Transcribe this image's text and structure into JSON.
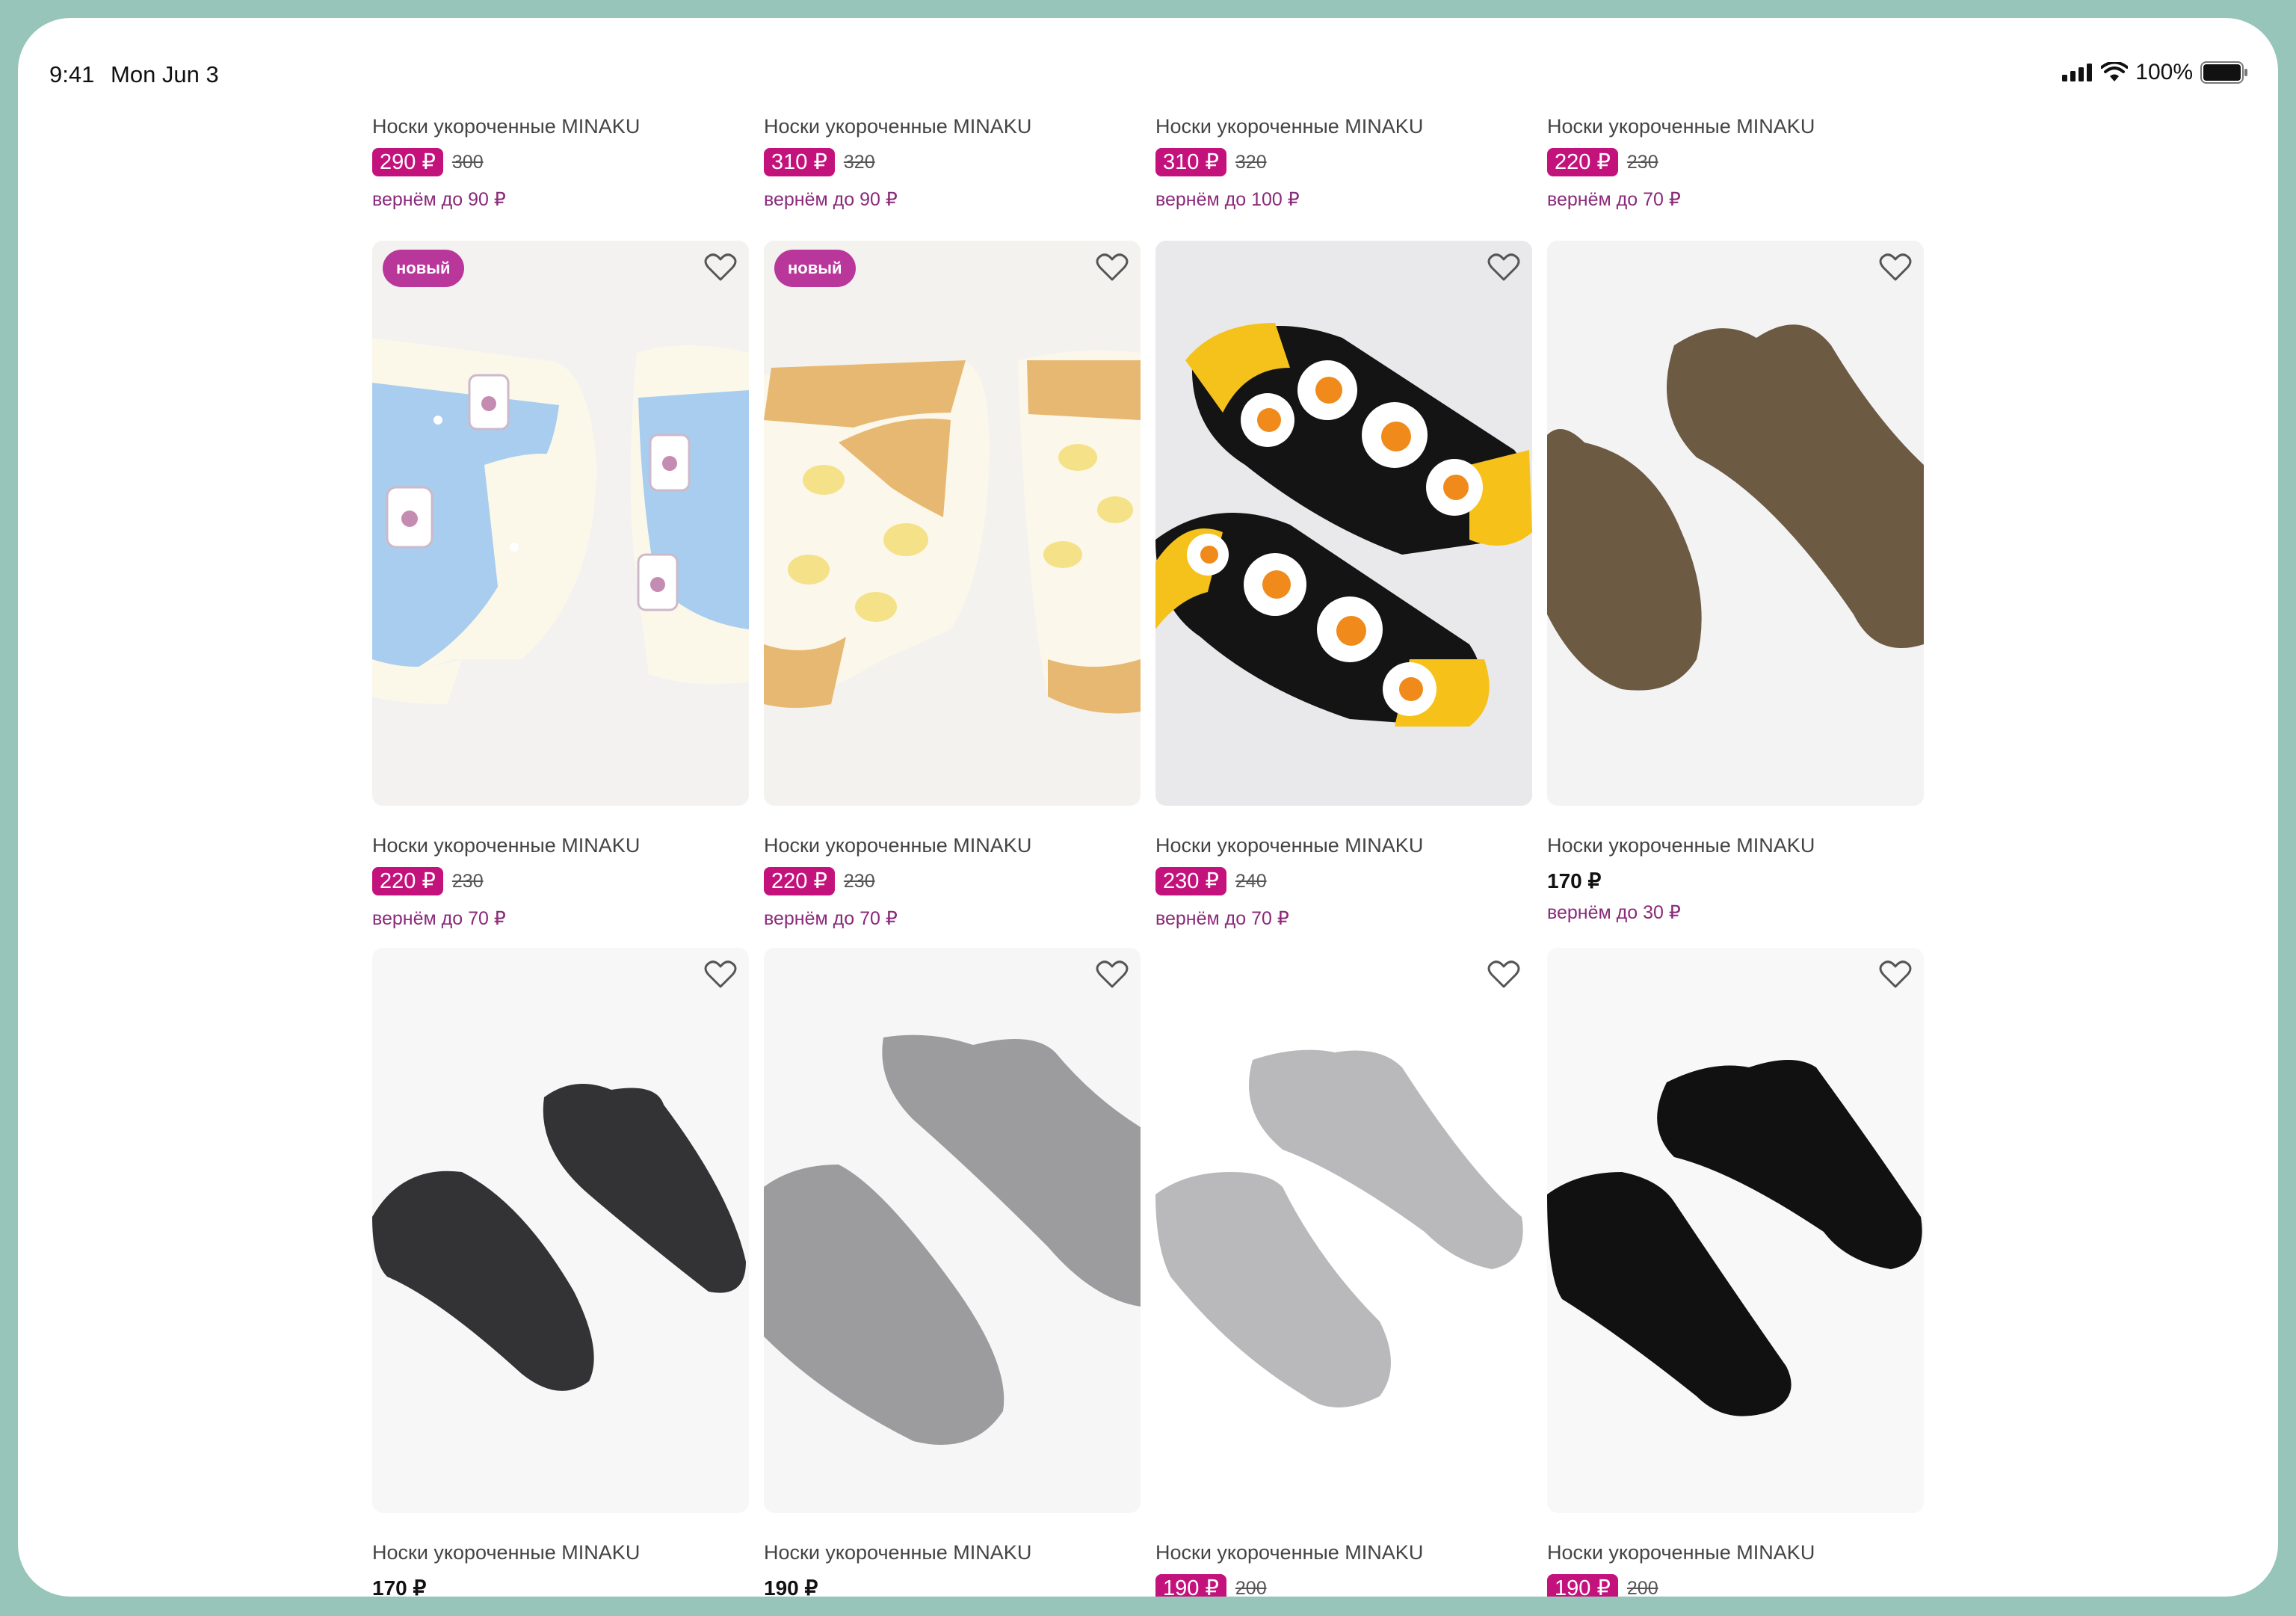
{
  "status_bar": {
    "time": "9:41",
    "date": "Mon Jun 3",
    "battery": "100%"
  },
  "badge_text": "новый",
  "products_top": [
    {
      "title": "Носки укороченные MINAKU",
      "price": "290 ₽",
      "old_price": "300",
      "cashback": "вернём до 90 ₽"
    },
    {
      "title": "Носки укороченные MINAKU",
      "price": "310 ₽",
      "old_price": "320",
      "cashback": "вернём до 90 ₽"
    },
    {
      "title": "Носки укороченные MINAKU",
      "price": "310 ₽",
      "old_price": "320",
      "cashback": "вернём до 100 ₽"
    },
    {
      "title": "Носки укороченные MINAKU",
      "price": "220 ₽",
      "old_price": "230",
      "cashback": "вернём до 70 ₽"
    }
  ],
  "products_middle": [
    {
      "title": "Носки укороченные MINAKU",
      "price": "220 ₽",
      "old_price": "230",
      "cashback": "вернём до 70 ₽",
      "new": true,
      "image": "blue-bottle-socks"
    },
    {
      "title": "Носки укороченные MINAKU",
      "price": "220 ₽",
      "old_price": "230",
      "cashback": "вернём до 70 ₽",
      "new": true,
      "image": "lemon-socks"
    },
    {
      "title": "Носки укороченные MINAKU",
      "price": "230 ₽",
      "old_price": "240",
      "cashback": "вернём до 70 ₽",
      "new": false,
      "image": "egg-socks"
    },
    {
      "title": "Носки укороченные MINAKU",
      "price": "170 ₽",
      "old_price": "",
      "cashback": "вернём до 30 ₽",
      "new": false,
      "image": "brown-socks"
    }
  ],
  "products_bottom": [
    {
      "title": "Носки укороченные MINAKU",
      "price": "170 ₽",
      "old_price": "",
      "image": "dark-grey-socks"
    },
    {
      "title": "Носки укороченные MINAKU",
      "price": "190 ₽",
      "old_price": "",
      "image": "grey-socks"
    },
    {
      "title": "Носки укороченные MINAKU",
      "price": "190 ₽",
      "old_price": "200",
      "image": "light-grey-socks"
    },
    {
      "title": "Носки укороченные MINAKU",
      "price": "190 ₽",
      "old_price": "200",
      "image": "black-socks"
    }
  ],
  "colors": {
    "sale": "#c4127d",
    "badge": "#b9379a",
    "cashback": "#8a2a7a",
    "frame": "#97c5b9"
  }
}
